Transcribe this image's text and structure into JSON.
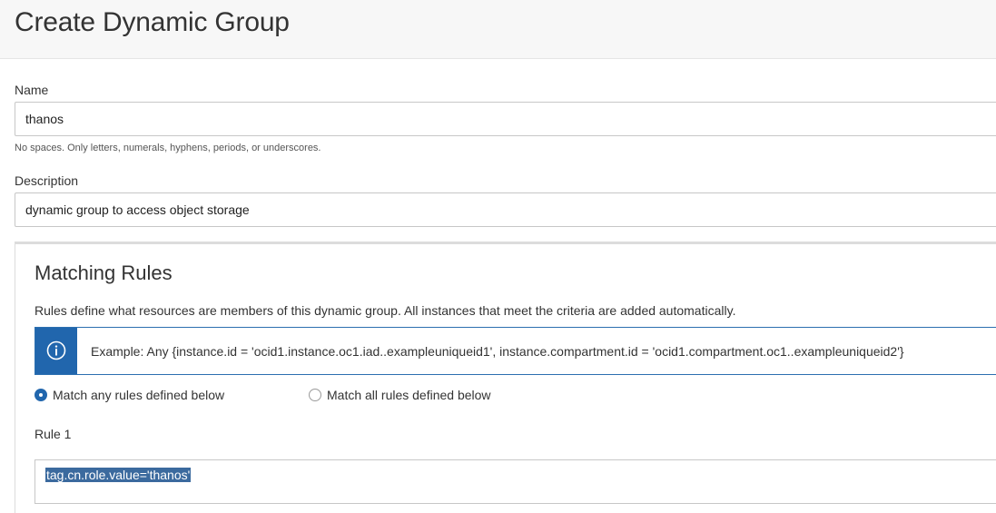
{
  "page": {
    "title": "Create Dynamic Group"
  },
  "form": {
    "name": {
      "label": "Name",
      "value": "thanos",
      "hint": "No spaces. Only letters, numerals, hyphens, periods, or underscores."
    },
    "description": {
      "label": "Description",
      "value": "dynamic group to access object storage"
    }
  },
  "matching_rules": {
    "title": "Matching Rules",
    "description": "Rules define what resources are members of this dynamic group. All instances that meet the criteria are added automatically.",
    "info_icon": "info-circle-icon",
    "example": "Example: Any {instance.id = 'ocid1.instance.oc1.iad..exampleuniqueid1', instance.compartment.id = 'ocid1.compartment.oc1..exampleuniqueid2'}",
    "options": [
      {
        "label": "Match any rules defined below",
        "selected": true
      },
      {
        "label": "Match all rules defined below",
        "selected": false
      }
    ],
    "rules": [
      {
        "label": "Rule 1",
        "value": "tag.cn.role.value='thanos'"
      }
    ]
  },
  "colors": {
    "accent": "#2166ad",
    "selection": "#3b6a9e",
    "header_bg": "#f7f7f7"
  }
}
